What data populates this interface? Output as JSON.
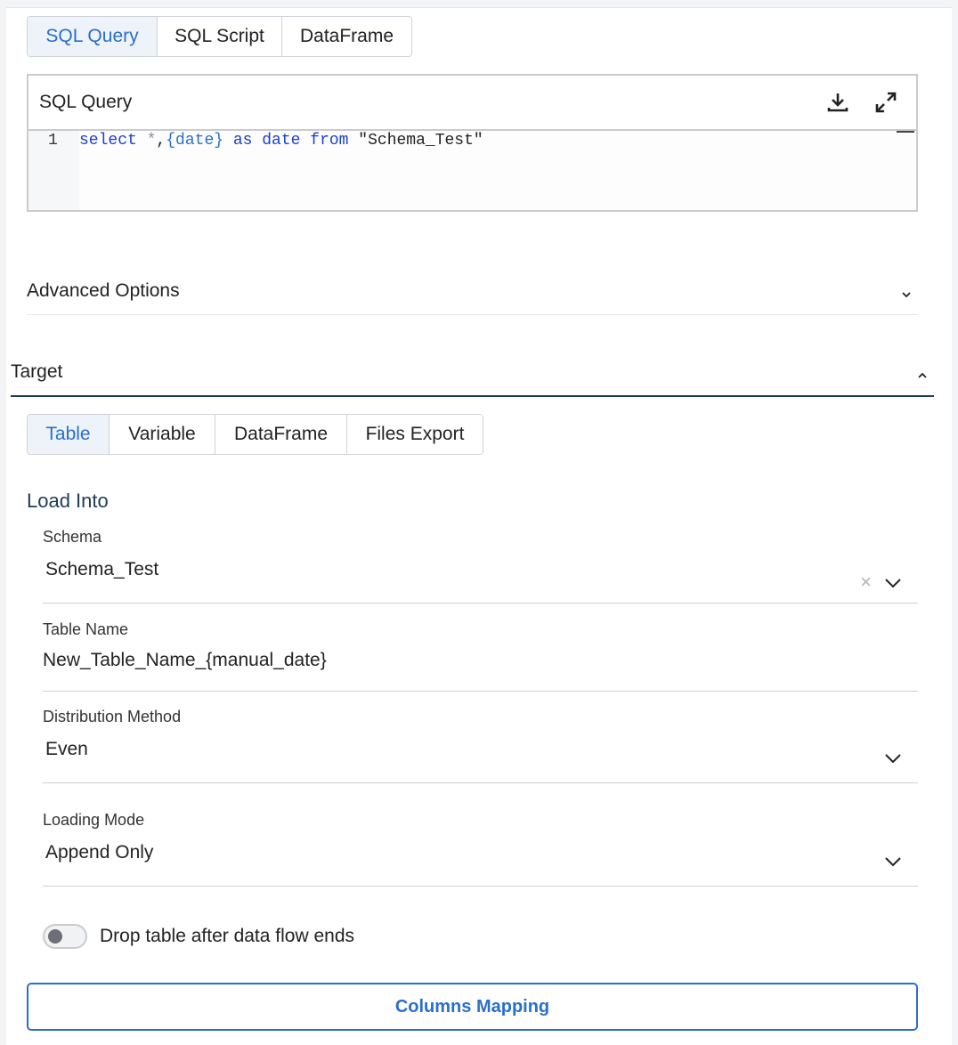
{
  "source_tabs": [
    {
      "label": "SQL Query",
      "active": true
    },
    {
      "label": "SQL Script",
      "active": false
    },
    {
      "label": "DataFrame",
      "active": false
    }
  ],
  "editor": {
    "title": "SQL Query",
    "icons": [
      "download-icon",
      "expand-icon"
    ],
    "line_number": "1",
    "code": {
      "kw_select": "select",
      "star": " *",
      "comma": ",",
      "template": "{date}",
      "kw_as": " as",
      "ident": " date",
      "kw_from": " from",
      "table": " \"Schema_Test\""
    }
  },
  "advanced_options": {
    "label": "Advanced Options",
    "icon": "chevron-down-icon"
  },
  "target": {
    "label": "Target",
    "icon": "chevron-up-icon"
  },
  "target_tabs": [
    {
      "label": "Table",
      "active": true
    },
    {
      "label": "Variable",
      "active": false
    },
    {
      "label": "DataFrame",
      "active": false
    },
    {
      "label": "Files Export",
      "active": false
    }
  ],
  "load_into": {
    "label": "Load Into"
  },
  "fields": {
    "schema": {
      "label": "Schema",
      "value": "Schema_Test",
      "clear": "×"
    },
    "table_name": {
      "label": "Table Name",
      "value": "New_Table_Name_{manual_date}"
    },
    "distribution": {
      "label": "Distribution Method",
      "value": "Even"
    },
    "loading_mode": {
      "label": "Loading Mode",
      "value": "Append Only"
    }
  },
  "drop_table": {
    "label": "Drop table after data flow ends",
    "checked": false
  },
  "columns_mapping": {
    "label": "Columns Mapping"
  },
  "colors": {
    "accent": "#2a6fc9",
    "active_tab_bg": "#eef3f9",
    "target_underline": "#1f3b5a"
  }
}
